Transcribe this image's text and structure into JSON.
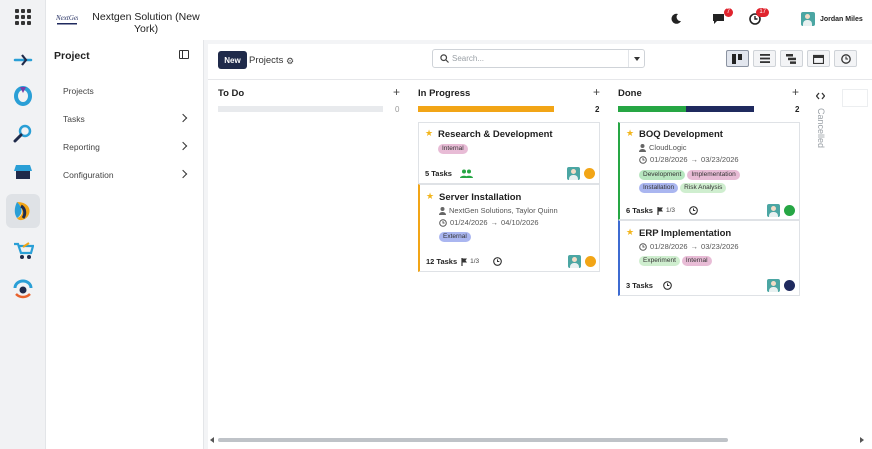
{
  "org": {
    "name": "Nextgen Solution (New York)",
    "logo_text": "NextGen"
  },
  "user": {
    "name": "Jordan Miles",
    "messages_count": "7",
    "activities_count": "17"
  },
  "sidebar": {
    "title": "Project",
    "items": [
      {
        "label": "Projects",
        "has_children": false
      },
      {
        "label": "Tasks",
        "has_children": true
      },
      {
        "label": "Reporting",
        "has_children": true
      },
      {
        "label": "Configuration",
        "has_children": true
      }
    ]
  },
  "control": {
    "new_label": "New",
    "breadcrumb": "Projects",
    "search_placeholder": "Search..."
  },
  "columns": [
    {
      "title": "To Do",
      "count": "0"
    },
    {
      "title": "In Progress",
      "count": "2"
    },
    {
      "title": "Done",
      "count": "2"
    }
  ],
  "folded_column": "Cancelled",
  "cards": {
    "research": {
      "title": "Research & Development",
      "tags": [
        "Internal"
      ],
      "tasks": "5 Tasks",
      "status_color": "#f2a516"
    },
    "server": {
      "title": "Server Installation",
      "customer": "NextGen Solutions, Taylor Quinn",
      "start": "01/24/2026",
      "end": "04/10/2026",
      "tags": [
        "External"
      ],
      "tasks": "12 Tasks",
      "milestones": "1/3",
      "status_color": "#f2a516"
    },
    "boq": {
      "title": "BOQ Development",
      "customer": "CloudLogic",
      "start": "01/28/2026",
      "end": "03/23/2026",
      "tags": [
        "Development",
        "Implementation",
        "Installation",
        "Risk Analysis"
      ],
      "tasks": "6 Tasks",
      "milestones": "1/3",
      "status_color": "#26a644"
    },
    "erp": {
      "title": "ERP Implementation",
      "start": "01/28/2026",
      "end": "03/23/2026",
      "tags": [
        "Experiment",
        "Internal"
      ],
      "tasks": "3 Tasks",
      "status_color": "#1f2a5e"
    }
  },
  "colors": {
    "accent": "#1f2a4a",
    "in_progress": "#f2a516",
    "done_green": "#26a644",
    "done_navy": "#1f2a5e"
  }
}
